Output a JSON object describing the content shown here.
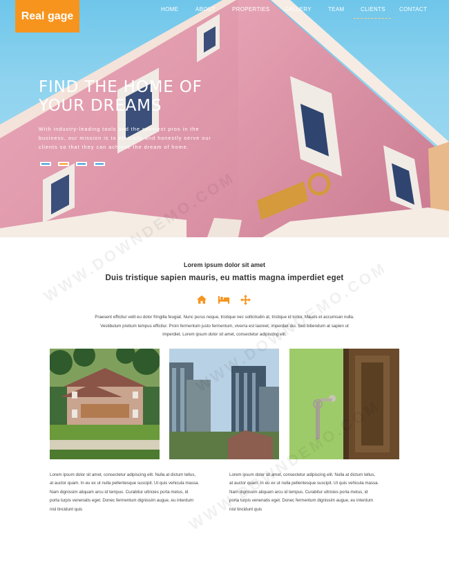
{
  "brand": {
    "logo_text": "Real gage",
    "accent": "#f7941d"
  },
  "nav": {
    "items": [
      {
        "label": "HOME"
      },
      {
        "label": "ABOUT"
      },
      {
        "label": "PROPERTIES"
      },
      {
        "label": "GALLERY"
      },
      {
        "label": "TEAM"
      },
      {
        "label": "CLIENTS"
      },
      {
        "label": "CONTACT"
      }
    ]
  },
  "hero": {
    "title_line1": "FIND THE HOME OF",
    "title_line2": "YOUR DREAMS",
    "text_line1": "With industry-leading tools and the savviest pros in the",
    "text_line2": "business, our mission is to ethically and honestly serve our",
    "text_line3": "clients so that they can achieve the dream of home.",
    "active_slide": 1
  },
  "intro": {
    "subheading": "Lorem ipsum dolor sit amet",
    "heading": "Duis tristique sapien mauris, eu mattis magna imperdiet eget",
    "icons": [
      "home-icon",
      "bed-icon",
      "move-icon"
    ],
    "line1": "Praesent efficitur velit eu dolor fringilla feugiat. Nunc purus neque, tristique nec sollicitudin at, tristique id tortor. Mauris et accumsan nulla.",
    "line2": "Vestibulum pretium tempus efficitur. Proin fermentum justo fermentum, viverra est laoreet, imperdiet dui. Sed bibendum at sapien ut",
    "line3": "imperdiet. Lorem ipsum dolor sit amet, consectetur adipiscing elit."
  },
  "columns": [
    {
      "l1": "Lorem ipsum dolor sit amet, consectetur adipiscing elit. Nulla at dictum tellus,",
      "l2": "at auctor quam. In eu ex ut nulla pellentesque suscipit. Ut quis vehicula massa.",
      "l3": "Nam dignissim aliquam arcu id tempus. Curabitur ultricies porta metus, id",
      "l4": "porta turpis venenatis eget. Donec fermentum dignissim augue, eu interdum",
      "l5": "nisl tincidunt quis"
    },
    {
      "l1": "Lorem ipsum dolor sit amet, consectetur adipiscing elit. Nulla at dictum tellus,",
      "l2": "at auctor quam. In eu ex ut nulla pellentesque suscipit. Ut quis vehicula massa.",
      "l3": "Nam dignissim aliquam arcu id tempus. Curabitur ultricies porta metus, id",
      "l4": "porta turpis venenatis eget. Donec fermentum dignissim augue, eu interdum",
      "l5": "nisl tincidunt quis"
    }
  ],
  "watermark": "WWW.DOWNDEMO.COM"
}
